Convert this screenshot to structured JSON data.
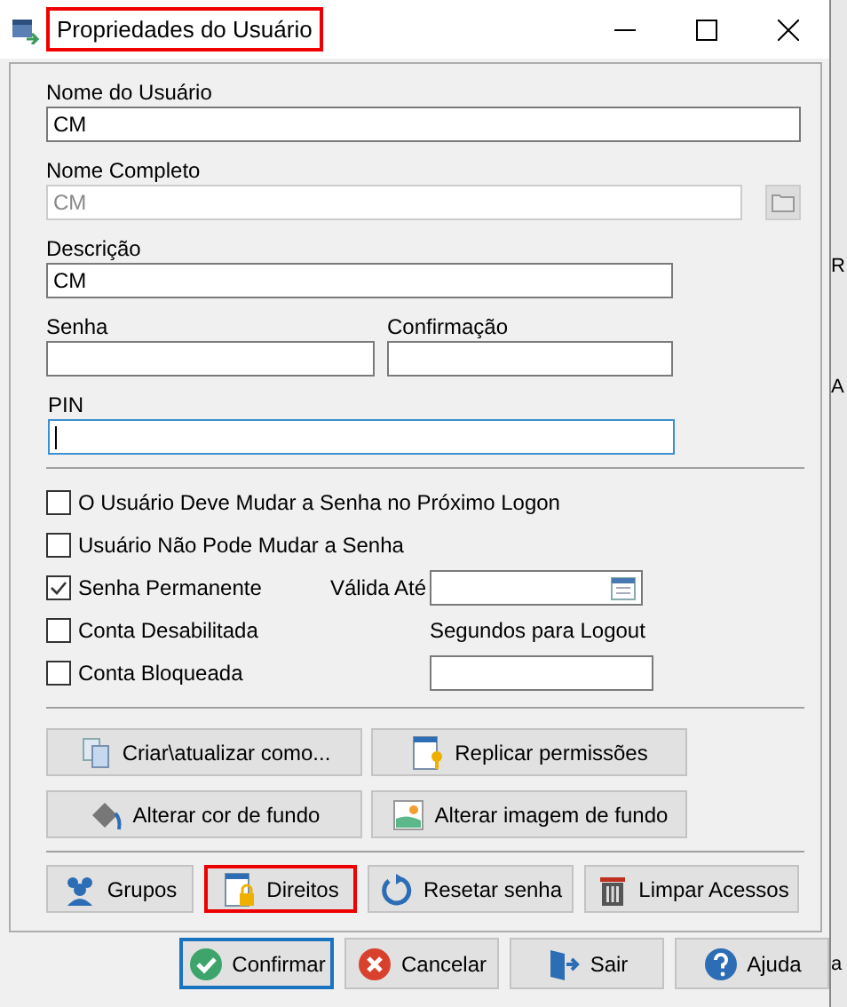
{
  "window": {
    "title": "Propriedades do Usuário",
    "highlighted": true
  },
  "user_name": {
    "label": "Nome do Usuário",
    "value": "CM"
  },
  "full_name": {
    "label": "Nome Completo",
    "value": "CM",
    "disabled": true
  },
  "description": {
    "label": "Descrição",
    "value": "CM"
  },
  "password": {
    "label": "Senha"
  },
  "confirmation": {
    "label": "Confirmação"
  },
  "pin": {
    "label": "PIN",
    "focused": true
  },
  "checkboxes": [
    {
      "label": "O Usuário Deve Mudar a Senha no Próximo Logon",
      "checked": false
    },
    {
      "label": "Usuário Não Pode Mudar a Senha",
      "checked": false
    },
    {
      "label": "Senha Permanente",
      "checked": true
    },
    {
      "label": "Conta Desabilitada",
      "checked": false
    },
    {
      "label": "Conta Bloqueada",
      "checked": false
    }
  ],
  "valid_until": {
    "label": "Válida Até"
  },
  "logout_seconds": {
    "label": "Segundos para Logout"
  },
  "tool_buttons": [
    {
      "label": "Criar\\atualizar como...",
      "kind": "copy"
    },
    {
      "label": "Replicar permissões",
      "kind": "keydoc"
    },
    {
      "label": "Alterar cor de fundo",
      "kind": "paint"
    },
    {
      "label": "Alterar imagem de fundo",
      "kind": "image"
    }
  ],
  "access_buttons": [
    {
      "label": "Grupos",
      "kind": "group",
      "highlighted": false
    },
    {
      "label": "Direitos",
      "kind": "lockdoc",
      "highlighted": true
    },
    {
      "label": "Resetar senha",
      "kind": "reset",
      "highlighted": false
    },
    {
      "label": "Limpar Acessos",
      "kind": "trash",
      "highlighted": false
    }
  ],
  "footer_buttons": [
    {
      "label": "Confirmar",
      "kind": "check",
      "default": true
    },
    {
      "label": "Cancelar",
      "kind": "cancel",
      "default": false
    },
    {
      "label": "Sair",
      "kind": "exit",
      "default": false
    },
    {
      "label": "Ajuda",
      "kind": "help",
      "default": false
    }
  ],
  "background_fragments": [
    "R",
    "A",
    "a"
  ]
}
